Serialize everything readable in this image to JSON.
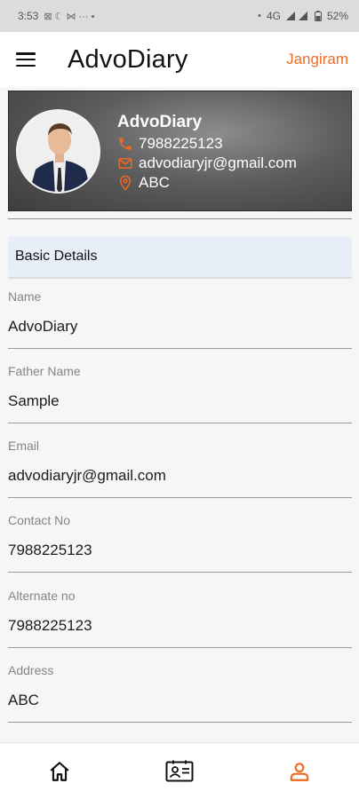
{
  "status_bar": {
    "time": "3:53",
    "left_icons": "⊠  ☾  ⋈  ···  •",
    "network": "4G",
    "battery": "52%"
  },
  "app_bar": {
    "title": "AdvoDiary",
    "user_name": "Jangiram"
  },
  "profile": {
    "name": "AdvoDiary",
    "phone": "7988225123",
    "email": "advodiaryjr@gmail.com",
    "location": "ABC"
  },
  "section": {
    "title": "Basic Details"
  },
  "fields": [
    {
      "label": "Name",
      "value": "AdvoDiary"
    },
    {
      "label": "Father Name",
      "value": "Sample"
    },
    {
      "label": "Email",
      "value": "advodiaryjr@gmail.com"
    },
    {
      "label": "Contact No",
      "value": "7988225123"
    },
    {
      "label": "Alternate no",
      "value": "7988225123"
    },
    {
      "label": "Address",
      "value": "ABC"
    }
  ],
  "bottom_nav": {
    "items": [
      {
        "icon": "home-icon"
      },
      {
        "icon": "contact-card-icon"
      },
      {
        "icon": "person-icon"
      }
    ]
  },
  "colors": {
    "accent": "#ef6a1f",
    "header_bg": "#e8eef8"
  }
}
